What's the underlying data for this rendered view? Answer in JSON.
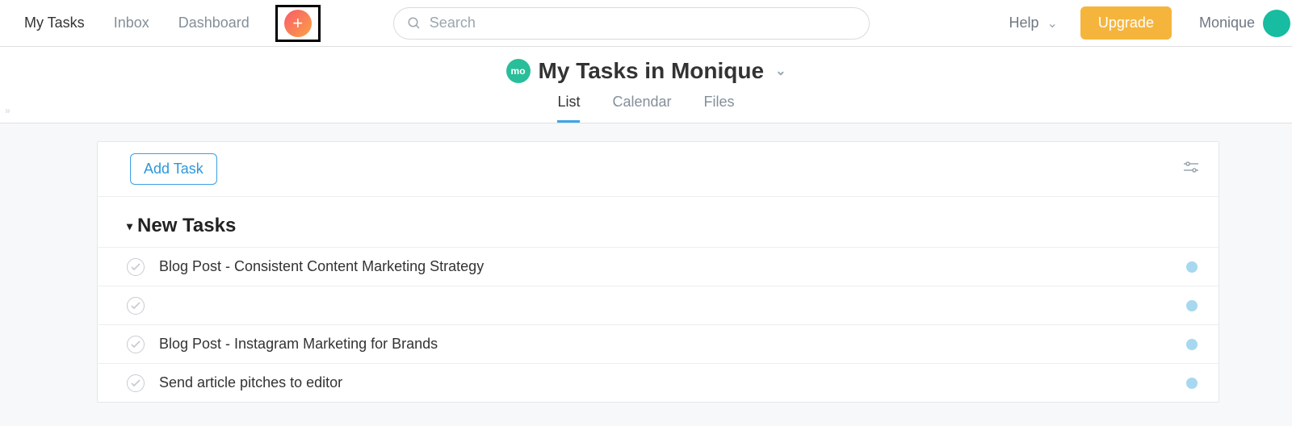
{
  "nav": {
    "items": [
      {
        "label": "My Tasks",
        "active": true
      },
      {
        "label": "Inbox",
        "active": false
      },
      {
        "label": "Dashboard",
        "active": false
      }
    ],
    "help_label": "Help",
    "upgrade_label": "Upgrade",
    "user_name": "Monique"
  },
  "search": {
    "placeholder": "Search",
    "value": ""
  },
  "header": {
    "avatar_text": "mo",
    "title": "My Tasks in Monique",
    "tabs": [
      {
        "label": "List",
        "active": true
      },
      {
        "label": "Calendar",
        "active": false
      },
      {
        "label": "Files",
        "active": false
      }
    ]
  },
  "toolbar": {
    "add_task_label": "Add Task"
  },
  "sections": [
    {
      "title": "New Tasks",
      "tasks": [
        {
          "title": "Blog Post - Consistent Content Marketing Strategy"
        },
        {
          "title": ""
        },
        {
          "title": "Blog Post - Instagram Marketing for Brands"
        },
        {
          "title": "Send article pitches to editor"
        }
      ]
    }
  ]
}
